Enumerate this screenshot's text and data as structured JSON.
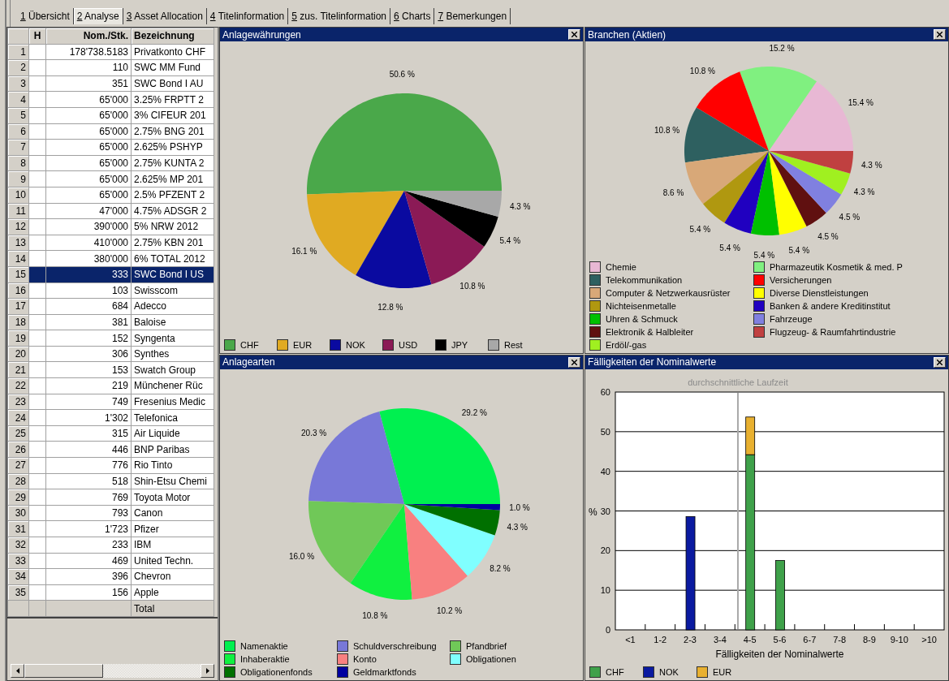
{
  "tabs": [
    {
      "key": "1",
      "label": "Übersicht",
      "selected": false
    },
    {
      "key": "2",
      "label": "Analyse",
      "selected": true
    },
    {
      "key": "3",
      "label": "Asset Allocation",
      "selected": false
    },
    {
      "key": "4",
      "label": "Titelinformation",
      "selected": false
    },
    {
      "key": "5",
      "label": "zus. Titelinformation",
      "selected": false
    },
    {
      "key": "6",
      "label": "Charts",
      "selected": false
    },
    {
      "key": "7",
      "label": "Bemerkungen",
      "selected": false
    }
  ],
  "table": {
    "columns": [
      "H",
      "Nom./Stk.",
      "Bezeichnung"
    ],
    "rows": [
      {
        "number": "1",
        "nominal": "178'738.5183",
        "name": "Privatkonto CHF",
        "selected": false
      },
      {
        "number": "2",
        "nominal": "110",
        "name": "SWC MM Fund",
        "selected": false
      },
      {
        "number": "3",
        "nominal": "351",
        "name": "SWC Bond I AU",
        "selected": false
      },
      {
        "number": "4",
        "nominal": "65'000",
        "name": "3.25% FRPTT 2",
        "selected": false
      },
      {
        "number": "5",
        "nominal": "65'000",
        "name": "3% CIFEUR 201",
        "selected": false
      },
      {
        "number": "6",
        "nominal": "65'000",
        "name": "2.75% BNG 201",
        "selected": false
      },
      {
        "number": "7",
        "nominal": "65'000",
        "name": "2.625% PSHYP",
        "selected": false
      },
      {
        "number": "8",
        "nominal": "65'000",
        "name": "2.75% KUNTA 2",
        "selected": false
      },
      {
        "number": "9",
        "nominal": "65'000",
        "name": "2.625% MP 201",
        "selected": false
      },
      {
        "number": "10",
        "nominal": "65'000",
        "name": "2.5% PFZENT 2",
        "selected": false
      },
      {
        "number": "11",
        "nominal": "47'000",
        "name": "4.75% ADSGR 2",
        "selected": false
      },
      {
        "number": "12",
        "nominal": "390'000",
        "name": "5% NRW 2012",
        "selected": false
      },
      {
        "number": "13",
        "nominal": "410'000",
        "name": "2.75% KBN 201",
        "selected": false
      },
      {
        "number": "14",
        "nominal": "380'000",
        "name": "6% TOTAL 2012",
        "selected": false
      },
      {
        "number": "15",
        "nominal": "333",
        "name": "SWC Bond I US",
        "selected": true
      },
      {
        "number": "16",
        "nominal": "103",
        "name": "Swisscom",
        "selected": false
      },
      {
        "number": "17",
        "nominal": "684",
        "name": "Adecco",
        "selected": false
      },
      {
        "number": "18",
        "nominal": "381",
        "name": "Baloise",
        "selected": false
      },
      {
        "number": "19",
        "nominal": "152",
        "name": "Syngenta",
        "selected": false
      },
      {
        "number": "20",
        "nominal": "306",
        "name": "Synthes",
        "selected": false
      },
      {
        "number": "21",
        "nominal": "153",
        "name": "Swatch Group",
        "selected": false
      },
      {
        "number": "22",
        "nominal": "219",
        "name": "Münchener Rüc",
        "selected": false
      },
      {
        "number": "23",
        "nominal": "749",
        "name": "Fresenius Medic",
        "selected": false
      },
      {
        "number": "24",
        "nominal": "1'302",
        "name": "Telefonica",
        "selected": false
      },
      {
        "number": "25",
        "nominal": "315",
        "name": "Air Liquide",
        "selected": false
      },
      {
        "number": "26",
        "nominal": "446",
        "name": "BNP Paribas",
        "selected": false
      },
      {
        "number": "27",
        "nominal": "776",
        "name": "Rio Tinto",
        "selected": false
      },
      {
        "number": "28",
        "nominal": "518",
        "name": "Shin-Etsu Chemi",
        "selected": false
      },
      {
        "number": "29",
        "nominal": "769",
        "name": "Toyota Motor",
        "selected": false
      },
      {
        "number": "30",
        "nominal": "793",
        "name": "Canon",
        "selected": false
      },
      {
        "number": "31",
        "nominal": "1'723",
        "name": "Pfizer",
        "selected": false
      },
      {
        "number": "32",
        "nominal": "233",
        "name": "IBM",
        "selected": false
      },
      {
        "number": "33",
        "nominal": "469",
        "name": "United Techn.",
        "selected": false
      },
      {
        "number": "34",
        "nominal": "396",
        "name": "Chevron",
        "selected": false
      },
      {
        "number": "35",
        "nominal": "156",
        "name": "Apple",
        "selected": false
      }
    ],
    "total": "Total"
  },
  "panels": [
    {
      "title": "Anlagewährungen",
      "chart_data": {
        "type": "pie",
        "categories": [
          "CHF",
          "EUR",
          "NOK",
          "USD",
          "JPY",
          "Rest"
        ],
        "values": [
          50.6,
          16.1,
          12.8,
          10.8,
          5.4,
          4.3
        ],
        "value_labels": [
          "50.6 %",
          "16.1 %",
          "12.8 %",
          "10.8 %",
          "5.4 %",
          "4.3 %"
        ],
        "colors": [
          "#4aa84a",
          "#e0aa22",
          "#0a0aa0",
          "#8b1a56",
          "#000000",
          "#a8a8a8"
        ]
      }
    },
    {
      "title": "Branchen (Aktien)",
      "chart_data": {
        "type": "pie",
        "categories": [
          "Chemie",
          "Pharmazeutik Kosmetik & med. P",
          "Versicherungen",
          "Telekommunikation",
          "Computer & Netzwerkausrüster",
          "Nichteisenmetalle",
          "Banken & andere Kreditinstitut",
          "Uhren & Schmuck",
          "Diverse Dienstleistungen",
          "Elektronik & Halbleiter",
          "Fahrzeuge",
          "Erdöl/-gas",
          "Flugzeug- & Raumfahrtindustrie"
        ],
        "values": [
          15.4,
          15.2,
          10.8,
          10.8,
          8.6,
          5.4,
          5.4,
          5.4,
          5.4,
          4.5,
          4.5,
          4.3,
          4.3
        ],
        "value_labels": [
          "15.4 %",
          "15.2 %",
          "10.8 %",
          "10.8 %",
          "8.6 %",
          "5.4 %",
          "5.4 %",
          "5.4 %",
          "5.4 %",
          "4.5 %",
          "4.5 %",
          "4.3 %",
          "4.3 %"
        ],
        "colors": [
          "#e8b8d4",
          "#80f080",
          "#ff0000",
          "#2e6060",
          "#d8a878",
          "#b09810",
          "#2000c0",
          "#00c000",
          "#ffff00",
          "#601010",
          "#8080e0",
          "#a0f020",
          "#c04040"
        ]
      }
    },
    {
      "title": "Anlagearten",
      "chart_data": {
        "type": "pie",
        "categories": [
          "Namenaktie",
          "Schuldverschreibung",
          "Pfandbrief",
          "Inhaberaktie",
          "Konto",
          "Obligationen",
          "Obligationenfonds",
          "Geldmarktfonds"
        ],
        "values": [
          29.2,
          20.3,
          16.0,
          10.8,
          10.2,
          8.2,
          4.3,
          1.0
        ],
        "value_labels": [
          "29.2 %",
          "20.3 %",
          "16.0 %",
          "10.8 %",
          "10.2 %",
          "8.2 %",
          "4.3 %",
          "1.0 %"
        ],
        "colors": [
          "#00f050",
          "#7878d8",
          "#70c858",
          "#10f040",
          "#f88080",
          "#80ffff",
          "#007000",
          "#0000a0"
        ]
      }
    },
    {
      "title": "Fälligkeiten der Nominalwerte",
      "chart_data": {
        "type": "bar",
        "stacked": true,
        "grid": true,
        "xlabel": "Fälligkeiten der Nominalwerte",
        "ylabel": "%",
        "categories": [
          "<1",
          "1-2",
          "2-3",
          "3-4",
          "4-5",
          "5-6",
          "6-7",
          "7-8",
          "8-9",
          "9-10",
          ">10"
        ],
        "ylim": [
          0,
          60
        ],
        "yticks": [
          {
            "value": 0,
            "label": "0"
          },
          {
            "value": 10,
            "label": "10"
          },
          {
            "value": 20,
            "label": "20"
          },
          {
            "value": 30,
            "label": "30"
          },
          {
            "value": 40,
            "label": "40"
          },
          {
            "value": 50,
            "label": "50"
          },
          {
            "value": 60,
            "label": "60"
          }
        ],
        "series": [
          {
            "name": "CHF",
            "color": "#3fa14a",
            "values": [
              0,
              0,
              0,
              0,
              44.2,
              17.5,
              0,
              0,
              0,
              0,
              0
            ]
          },
          {
            "name": "NOK",
            "color": "#0a1aa0",
            "values": [
              0,
              0,
              28.6,
              0,
              0,
              0,
              0,
              0,
              0,
              0,
              0
            ]
          },
          {
            "name": "EUR",
            "color": "#e8b030",
            "values": [
              0,
              0,
              0,
              0,
              9.5,
              0,
              0,
              0,
              0,
              0,
              0
            ]
          }
        ],
        "ref_lines": [
          {
            "axis": "x",
            "value": "4-5",
            "label": "durchschnittliche Laufzeit"
          }
        ]
      }
    }
  ]
}
